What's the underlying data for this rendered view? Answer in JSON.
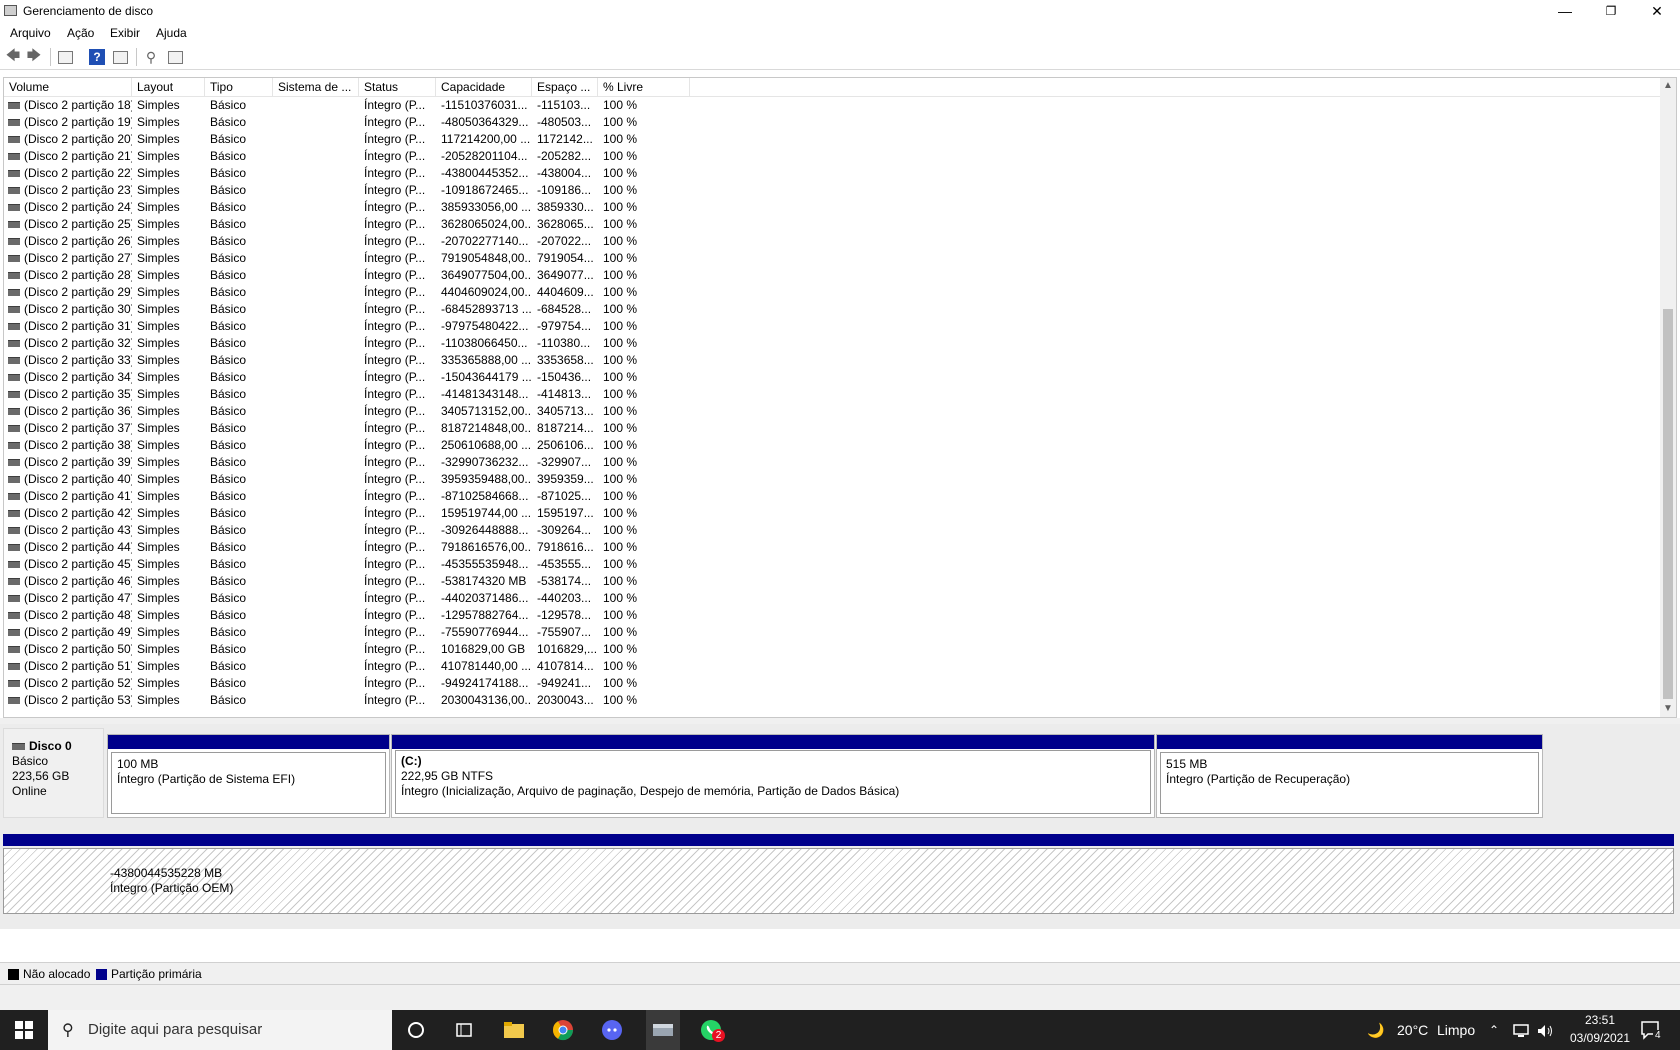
{
  "window": {
    "title": "Gerenciamento de disco",
    "minimize_glyph": "—",
    "restore_glyph": "❐",
    "close_glyph": "✕"
  },
  "menu": [
    "Arquivo",
    "Ação",
    "Exibir",
    "Ajuda"
  ],
  "toolbar": {
    "icons": [
      "back-arrow-icon",
      "forward-arrow-icon",
      "properties-icon",
      "help-icon",
      "console-tree-icon",
      "connect-icon",
      "settings-icon"
    ],
    "back_glyph": "🡄",
    "forward_glyph": "🡆",
    "help_glyph": "?",
    "connect_glyph": "⚲"
  },
  "columns": [
    "Volume",
    "Layout",
    "Tipo",
    "Sistema de ...",
    "Status",
    "Capacidade",
    "Espaço ...",
    "% Livre"
  ],
  "rows": [
    {
      "volume": "(Disco 2 partição 18)",
      "layout": "Simples",
      "tipo": "Básico",
      "fs": "",
      "status": "Íntegro (P...",
      "capacidade": "-11510376031...",
      "espaco": "-115103...",
      "livre": "100 %"
    },
    {
      "volume": "(Disco 2 partição 19)",
      "layout": "Simples",
      "tipo": "Básico",
      "fs": "",
      "status": "Íntegro (P...",
      "capacidade": "-48050364329...",
      "espaco": "-480503...",
      "livre": "100 %"
    },
    {
      "volume": "(Disco 2 partição 20)",
      "layout": "Simples",
      "tipo": "Básico",
      "fs": "",
      "status": "Íntegro (P...",
      "capacidade": "117214200,00 ...",
      "espaco": "1172142...",
      "livre": "100 %"
    },
    {
      "volume": "(Disco 2 partição 21)",
      "layout": "Simples",
      "tipo": "Básico",
      "fs": "",
      "status": "Íntegro (P...",
      "capacidade": "-20528201104...",
      "espaco": "-205282...",
      "livre": "100 %"
    },
    {
      "volume": "(Disco 2 partição 22)",
      "layout": "Simples",
      "tipo": "Básico",
      "fs": "",
      "status": "Íntegro (P...",
      "capacidade": "-43800445352...",
      "espaco": "-438004...",
      "livre": "100 %"
    },
    {
      "volume": "(Disco 2 partição 23)",
      "layout": "Simples",
      "tipo": "Básico",
      "fs": "",
      "status": "Íntegro (P...",
      "capacidade": "-10918672465...",
      "espaco": "-109186...",
      "livre": "100 %"
    },
    {
      "volume": "(Disco 2 partição 24)",
      "layout": "Simples",
      "tipo": "Básico",
      "fs": "",
      "status": "Íntegro (P...",
      "capacidade": "385933056,00 ...",
      "espaco": "3859330...",
      "livre": "100 %"
    },
    {
      "volume": "(Disco 2 partição 25)",
      "layout": "Simples",
      "tipo": "Básico",
      "fs": "",
      "status": "Íntegro (P...",
      "capacidade": "3628065024,00...",
      "espaco": "3628065...",
      "livre": "100 %"
    },
    {
      "volume": "(Disco 2 partição 26)",
      "layout": "Simples",
      "tipo": "Básico",
      "fs": "",
      "status": "Íntegro (P...",
      "capacidade": "-20702277140...",
      "espaco": "-207022...",
      "livre": "100 %"
    },
    {
      "volume": "(Disco 2 partição 27)",
      "layout": "Simples",
      "tipo": "Básico",
      "fs": "",
      "status": "Íntegro (P...",
      "capacidade": "7919054848,00...",
      "espaco": "7919054...",
      "livre": "100 %"
    },
    {
      "volume": "(Disco 2 partição 28)",
      "layout": "Simples",
      "tipo": "Básico",
      "fs": "",
      "status": "Íntegro (P...",
      "capacidade": "3649077504,00...",
      "espaco": "3649077...",
      "livre": "100 %"
    },
    {
      "volume": "(Disco 2 partição 29)",
      "layout": "Simples",
      "tipo": "Básico",
      "fs": "",
      "status": "Íntegro (P...",
      "capacidade": "4404609024,00...",
      "espaco": "4404609...",
      "livre": "100 %"
    },
    {
      "volume": "(Disco 2 partição 30)",
      "layout": "Simples",
      "tipo": "Básico",
      "fs": "",
      "status": "Íntegro (P...",
      "capacidade": "-68452893713 ...",
      "espaco": "-684528...",
      "livre": "100 %"
    },
    {
      "volume": "(Disco 2 partição 31)",
      "layout": "Simples",
      "tipo": "Básico",
      "fs": "",
      "status": "Íntegro (P...",
      "capacidade": "-97975480422...",
      "espaco": "-979754...",
      "livre": "100 %"
    },
    {
      "volume": "(Disco 2 partição 32)",
      "layout": "Simples",
      "tipo": "Básico",
      "fs": "",
      "status": "Íntegro (P...",
      "capacidade": "-11038066450...",
      "espaco": "-110380...",
      "livre": "100 %"
    },
    {
      "volume": "(Disco 2 partição 33)",
      "layout": "Simples",
      "tipo": "Básico",
      "fs": "",
      "status": "Íntegro (P...",
      "capacidade": "335365888,00 ...",
      "espaco": "3353658...",
      "livre": "100 %"
    },
    {
      "volume": "(Disco 2 partição 34)",
      "layout": "Simples",
      "tipo": "Básico",
      "fs": "",
      "status": "Íntegro (P...",
      "capacidade": "-15043644179 ...",
      "espaco": "-150436...",
      "livre": "100 %"
    },
    {
      "volume": "(Disco 2 partição 35)",
      "layout": "Simples",
      "tipo": "Básico",
      "fs": "",
      "status": "Íntegro (P...",
      "capacidade": "-41481343148...",
      "espaco": "-414813...",
      "livre": "100 %"
    },
    {
      "volume": "(Disco 2 partição 36)",
      "layout": "Simples",
      "tipo": "Básico",
      "fs": "",
      "status": "Íntegro (P...",
      "capacidade": "3405713152,00...",
      "espaco": "3405713...",
      "livre": "100 %"
    },
    {
      "volume": "(Disco 2 partição 37)",
      "layout": "Simples",
      "tipo": "Básico",
      "fs": "",
      "status": "Íntegro (P...",
      "capacidade": "8187214848,00...",
      "espaco": "8187214...",
      "livre": "100 %"
    },
    {
      "volume": "(Disco 2 partição 38)",
      "layout": "Simples",
      "tipo": "Básico",
      "fs": "",
      "status": "Íntegro (P...",
      "capacidade": "250610688,00 ...",
      "espaco": "2506106...",
      "livre": "100 %"
    },
    {
      "volume": "(Disco 2 partição 39)",
      "layout": "Simples",
      "tipo": "Básico",
      "fs": "",
      "status": "Íntegro (P...",
      "capacidade": "-32990736232...",
      "espaco": "-329907...",
      "livre": "100 %"
    },
    {
      "volume": "(Disco 2 partição 40)",
      "layout": "Simples",
      "tipo": "Básico",
      "fs": "",
      "status": "Íntegro (P...",
      "capacidade": "3959359488,00...",
      "espaco": "3959359...",
      "livre": "100 %"
    },
    {
      "volume": "(Disco 2 partição 41)",
      "layout": "Simples",
      "tipo": "Básico",
      "fs": "",
      "status": "Íntegro (P...",
      "capacidade": "-87102584668...",
      "espaco": "-871025...",
      "livre": "100 %"
    },
    {
      "volume": "(Disco 2 partição 42)",
      "layout": "Simples",
      "tipo": "Básico",
      "fs": "",
      "status": "Íntegro (P...",
      "capacidade": "159519744,00 ...",
      "espaco": "1595197...",
      "livre": "100 %"
    },
    {
      "volume": "(Disco 2 partição 43)",
      "layout": "Simples",
      "tipo": "Básico",
      "fs": "",
      "status": "Íntegro (P...",
      "capacidade": "-30926448888...",
      "espaco": "-309264...",
      "livre": "100 %"
    },
    {
      "volume": "(Disco 2 partição 44)",
      "layout": "Simples",
      "tipo": "Básico",
      "fs": "",
      "status": "Íntegro (P...",
      "capacidade": "7918616576,00...",
      "espaco": "7918616...",
      "livre": "100 %"
    },
    {
      "volume": "(Disco 2 partição 45)",
      "layout": "Simples",
      "tipo": "Básico",
      "fs": "",
      "status": "Íntegro (P...",
      "capacidade": "-45355535948...",
      "espaco": "-453555...",
      "livre": "100 %"
    },
    {
      "volume": "(Disco 2 partição 46)",
      "layout": "Simples",
      "tipo": "Básico",
      "fs": "",
      "status": "Íntegro (P...",
      "capacidade": "-538174320 MB",
      "espaco": "-538174...",
      "livre": "100 %"
    },
    {
      "volume": "(Disco 2 partição 47)",
      "layout": "Simples",
      "tipo": "Básico",
      "fs": "",
      "status": "Íntegro (P...",
      "capacidade": "-44020371486...",
      "espaco": "-440203...",
      "livre": "100 %"
    },
    {
      "volume": "(Disco 2 partição 48)",
      "layout": "Simples",
      "tipo": "Básico",
      "fs": "",
      "status": "Íntegro (P...",
      "capacidade": "-12957882764...",
      "espaco": "-129578...",
      "livre": "100 %"
    },
    {
      "volume": "(Disco 2 partição 49)",
      "layout": "Simples",
      "tipo": "Básico",
      "fs": "",
      "status": "Íntegro (P...",
      "capacidade": "-75590776944...",
      "espaco": "-755907...",
      "livre": "100 %"
    },
    {
      "volume": "(Disco 2 partição 50)",
      "layout": "Simples",
      "tipo": "Básico",
      "fs": "",
      "status": "Íntegro (P...",
      "capacidade": "1016829,00 GB",
      "espaco": "1016829,...",
      "livre": "100 %"
    },
    {
      "volume": "(Disco 2 partição 51)",
      "layout": "Simples",
      "tipo": "Básico",
      "fs": "",
      "status": "Íntegro (P...",
      "capacidade": "410781440,00 ...",
      "espaco": "4107814...",
      "livre": "100 %"
    },
    {
      "volume": "(Disco 2 partição 52)",
      "layout": "Simples",
      "tipo": "Básico",
      "fs": "",
      "status": "Íntegro (P...",
      "capacidade": "-94924174188...",
      "espaco": "-949241...",
      "livre": "100 %"
    },
    {
      "volume": "(Disco 2 partição 53)",
      "layout": "Simples",
      "tipo": "Básico",
      "fs": "",
      "status": "Íntegro (P...",
      "capacidade": "2030043136,00...",
      "espaco": "2030043...",
      "livre": "100 %"
    }
  ],
  "disk0": {
    "name": "Disco 0",
    "type": "Básico",
    "size": "223,56 GB",
    "state": "Online",
    "partitions": [
      {
        "label": "",
        "size": "100 MB",
        "status": "Íntegro (Partição de Sistema EFI)"
      },
      {
        "label": "(C:)",
        "size": "222,95 GB NTFS",
        "status": "Íntegro (Inicialização, Arquivo de paginação, Despejo de memória, Partição de Dados Básica)"
      },
      {
        "label": "",
        "size": "515 MB",
        "status": "Íntegro (Partição de Recuperação)"
      }
    ]
  },
  "oem_partition": {
    "size": "-4380044535228 MB",
    "status": "Íntegro (Partição OEM)"
  },
  "legend": [
    {
      "label": "Não alocado",
      "color": "#000000"
    },
    {
      "label": "Partição primária",
      "color": "#00008b"
    }
  ],
  "taskbar": {
    "start_icon": "windows-start-icon",
    "search_placeholder": "Digite aqui para pesquisar",
    "apps": [
      "cortana-icon",
      "task-view-icon",
      "file-explorer-icon",
      "chrome-icon",
      "discord-icon",
      "disk-management-icon",
      "whatsapp-icon"
    ],
    "whatsapp_badge": "2",
    "weather_glyph": "🌙",
    "temperature": "20°C",
    "weather_text": "Limpo",
    "time": "23:51",
    "date": "03/09/2021",
    "notification_count": "4"
  }
}
